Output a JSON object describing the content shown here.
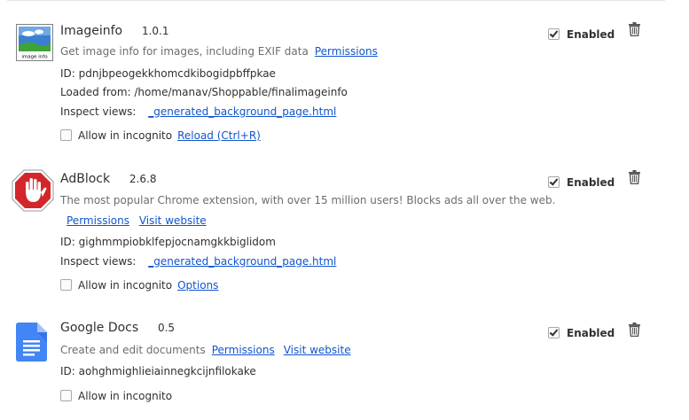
{
  "extensions": [
    {
      "name": "Imageinfo",
      "version": "1.0.1",
      "description": "Get image info for images, including EXIF data",
      "links": [
        "Permissions"
      ],
      "id_line": "ID: pdnjbpeogekkhomcdkibogidpbffpkae",
      "loaded_from": "Loaded from: /home/manav/Shoppable/finalimageinfo",
      "inspect_label": "Inspect views:",
      "inspect_link": "_generated_background_page.html",
      "incognito_label": "Allow in incognito",
      "incognito_link": "Reload (Ctrl+R)",
      "enabled_label": "Enabled",
      "icon_text": "image info",
      "icon": "imageinfo-logo-icon"
    },
    {
      "name": "AdBlock",
      "version": "2.6.8",
      "description": "The most popular Chrome extension, with over 15 million users! Blocks ads all over the web.",
      "links": [
        "Permissions",
        "Visit website"
      ],
      "id_line": "ID: gighmmpiobklfepjocnamgkkbiglidom",
      "inspect_label": "Inspect views:",
      "inspect_link": "_generated_background_page.html",
      "incognito_label": "Allow in incognito",
      "incognito_link": "Options",
      "enabled_label": "Enabled",
      "icon": "adblock-stop-hand-icon"
    },
    {
      "name": "Google Docs",
      "version": "0.5",
      "description": "Create and edit documents",
      "links": [
        "Permissions",
        "Visit website"
      ],
      "id_line": "ID: aohghmighlieiainnegkcijnfilokake",
      "incognito_label": "Allow in incognito",
      "enabled_label": "Enabled",
      "icon": "google-docs-icon"
    }
  ],
  "colors": {
    "link": "#1155cc",
    "muted": "#6d6d6d",
    "adblock_red": "#d3262b",
    "docs_blue": "#4285f4"
  }
}
